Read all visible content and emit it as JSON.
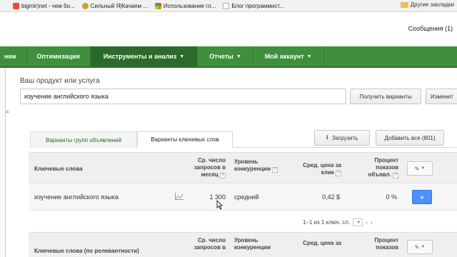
{
  "bookmarks": {
    "items": [
      {
        "label": "bigmir)net - чем бо...",
        "icon": "bigmir-icon",
        "color": "#e84a3c"
      },
      {
        "label": "Сильный Я|Качаем ...",
        "icon": "strong-icon",
        "color": "#c9a227"
      },
      {
        "label": "Использование гл...",
        "icon": "windows-icon",
        "color": "#3a7bd5"
      },
      {
        "label": "Блог программист...",
        "icon": "page-icon",
        "color": "#cccccc"
      }
    ],
    "other": "Другие закладки"
  },
  "account": {
    "label": "Сообщения (1)"
  },
  "nav": {
    "items": [
      "нии",
      "Оптимизация",
      "Инструменты и анализ",
      "Отчеты",
      "Мой аккаунт"
    ]
  },
  "product": {
    "label": "Ваш продукт или услуга",
    "value": "изучение английского языка",
    "get_variants": "Получить варианты",
    "modify": "Изменит"
  },
  "left_marker": "=",
  "tabs": {
    "ad_groups": "Варианты групп объявлений",
    "keywords": "Варианты ключевых слов"
  },
  "actions": {
    "download": "Загрузить",
    "add_all": "Добавить все (801)"
  },
  "table": {
    "headers": {
      "keyword": "Ключевые слова",
      "searches": [
        "Ср. число",
        "запросов в",
        "месяц"
      ],
      "competition": [
        "Уровень",
        "конкуренции"
      ],
      "cpc": [
        "Сред. цена за",
        "клик"
      ],
      "impressions": [
        "Процент",
        "показов",
        "объявл."
      ]
    },
    "rows": [
      {
        "keyword": "изучение английского языка",
        "searches": "1 300",
        "competition": "средний",
        "cpc": "0,42 $",
        "share": "0 %"
      }
    ],
    "edit_icon": "pencil-icon",
    "add_symbol": "»",
    "help_symbol": "?"
  },
  "pager": {
    "range": "1–1 из 1 ключ. сл.",
    "per_page": "",
    "prev": "‹",
    "next": "›"
  },
  "table2": {
    "headers": {
      "keyword": "Ключевые слова (по релевантности)",
      "searches": [
        "Ср. число",
        "запросов в"
      ],
      "competition": [
        "Уровень",
        "конкуренции"
      ],
      "cpc": [
        "Сред. цена за"
      ],
      "impressions": [
        "Процент",
        "показов"
      ]
    }
  }
}
